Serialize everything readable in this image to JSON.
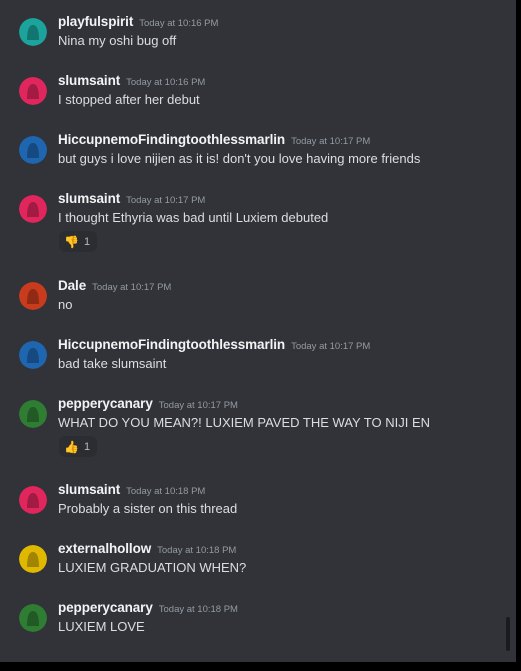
{
  "messages": [
    {
      "author": "playfulspirit",
      "time": "Today at 10:16 PM",
      "text": "Nina my oshi bug off",
      "avatar_color": "#1ba39c"
    },
    {
      "author": "slumsaint",
      "time": "Today at 10:16 PM",
      "text": "I stopped after her debut",
      "avatar_color": "#e0265c"
    },
    {
      "author": "HiccupnemoFindingtoothlessmarlin",
      "time": "Today at 10:17 PM",
      "text": "but guys i love nijien as it is! don't you love having more friends",
      "avatar_color": "#1e66b0"
    },
    {
      "author": "slumsaint",
      "time": "Today at 10:17 PM",
      "text": "I thought Ethyria was bad until Luxiem debuted",
      "avatar_color": "#e0265c",
      "reaction": {
        "emoji": "👎",
        "count": "1"
      }
    },
    {
      "author": "Dale",
      "time": "Today at 10:17 PM",
      "text": "no",
      "avatar_color": "#c83b1d"
    },
    {
      "author": "HiccupnemoFindingtoothlessmarlin",
      "time": "Today at 10:17 PM",
      "text": "bad take slumsaint",
      "avatar_color": "#1e66b0"
    },
    {
      "author": "pepperycanary",
      "time": "Today at 10:17 PM",
      "text": "WHAT DO YOU MEAN?! LUXIEM PAVED THE WAY TO NIJI EN",
      "avatar_color": "#2e7d32",
      "reaction": {
        "emoji": "👍",
        "count": "1"
      }
    },
    {
      "author": "slumsaint",
      "time": "Today at 10:18 PM",
      "text": "Probably a sister on this thread",
      "avatar_color": "#e0265c"
    },
    {
      "author": "externalhollow",
      "time": "Today at 10:18 PM",
      "text": "LUXIEM GRADUATION WHEN?",
      "avatar_color": "#e0b800"
    },
    {
      "author": "pepperycanary",
      "time": "Today at 10:18 PM",
      "text": "LUXIEM LOVE",
      "avatar_color": "#2e7d32"
    }
  ]
}
